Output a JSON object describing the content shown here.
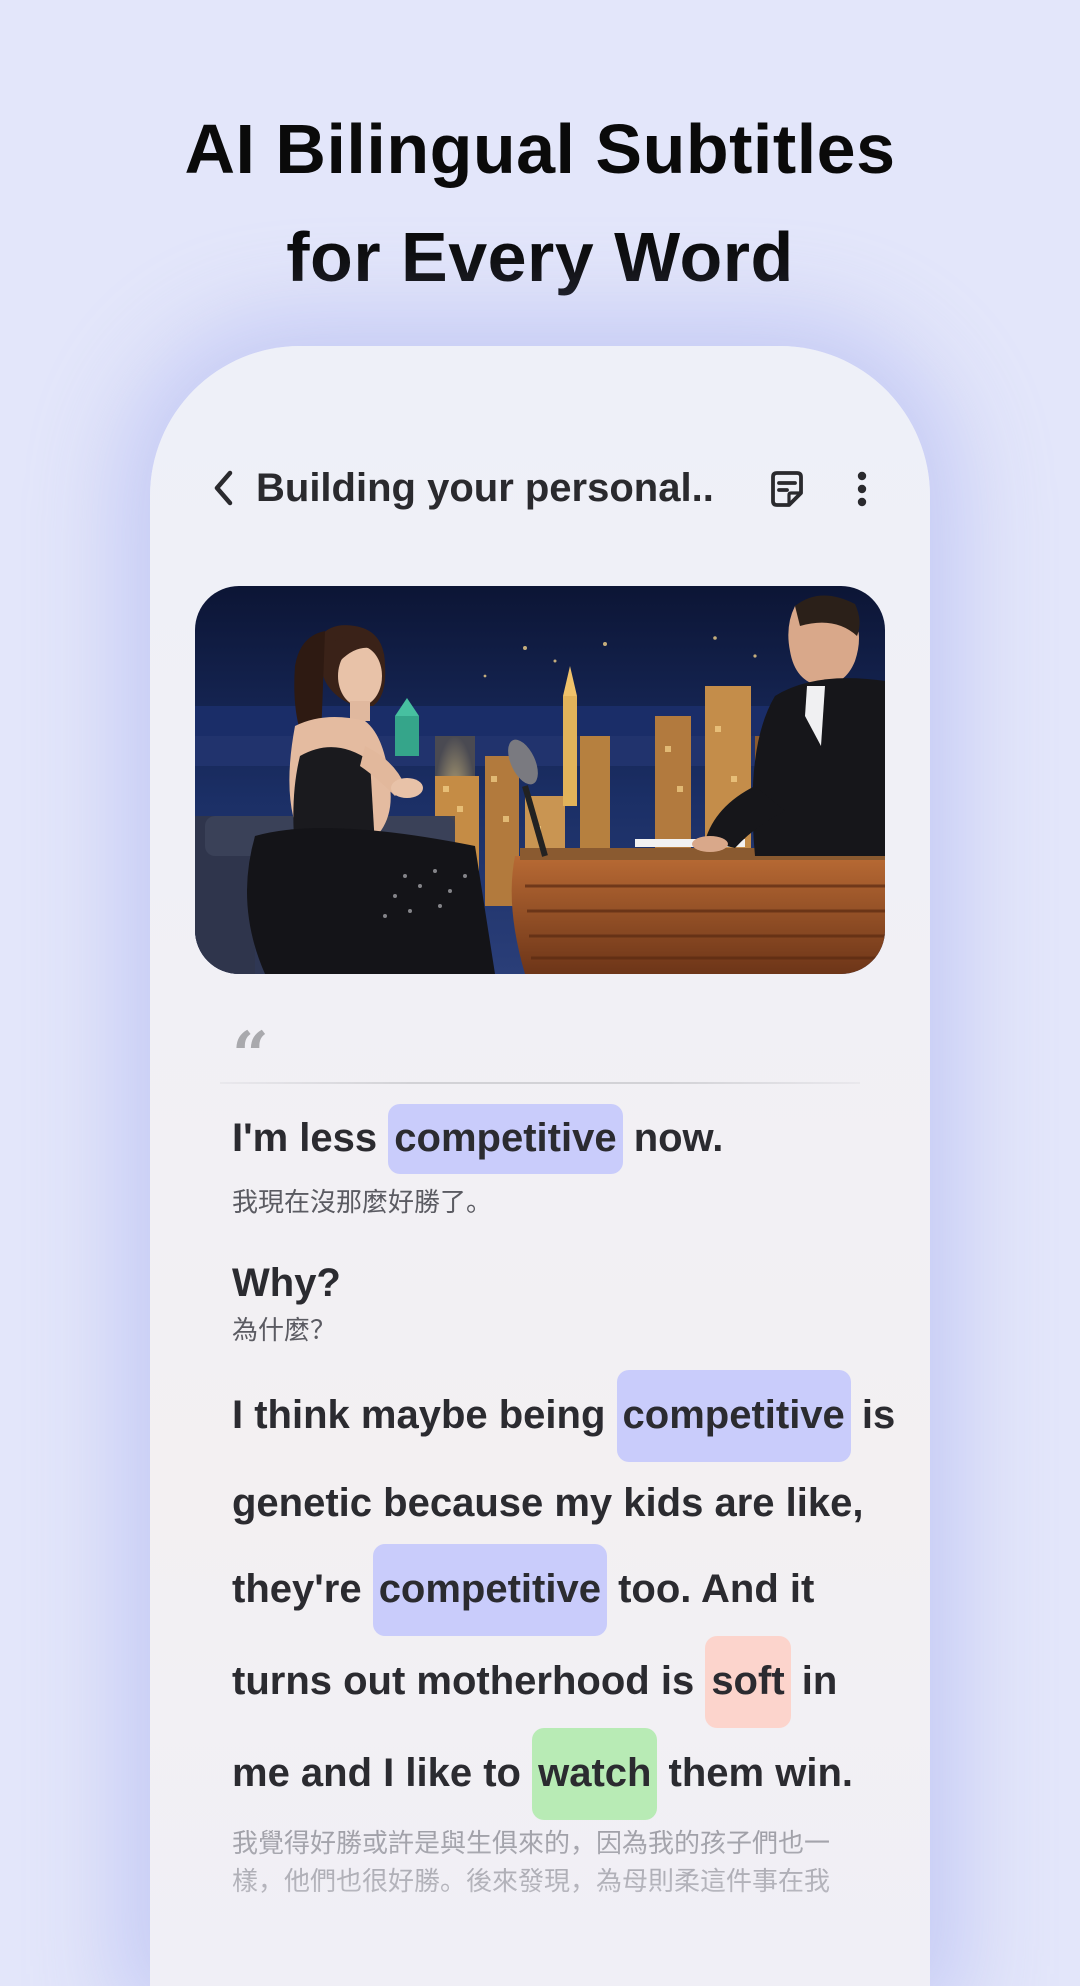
{
  "headline": {
    "line1": "AI Bilingual Subtitles",
    "line2": "for Every Word"
  },
  "header": {
    "back_icon": "chevron-left-icon",
    "title": "Building your personal...",
    "subtitle_icon": "subtitles-icon",
    "more_icon": "more-vertical-icon"
  },
  "video": {
    "thumbnail": "talk-show-interview-scene"
  },
  "quote_icon": "quote-icon",
  "quote_glyph": "“",
  "transcript": [
    {
      "en_parts": [
        "I'm less ",
        "competitive",
        " now."
      ],
      "zh": "我現在沒那麼好勝了。"
    },
    {
      "en": "Why?",
      "zh": "為什麼？"
    },
    {
      "en_lines": [
        [
          "I think maybe being ",
          "competitive",
          " is"
        ],
        [
          "genetic because my kids are like,"
        ],
        [
          "they're ",
          "competitive",
          " too. And it"
        ],
        [
          "turns out motherhood is ",
          "soft",
          " in"
        ],
        [
          "me and I like to ",
          "watch",
          " them win."
        ]
      ],
      "zh_lines": [
        "我覺得好勝或許是與生俱來的，因為我的孩子們也一",
        "樣，他們也很好勝。後來發現，為母則柔這件事在我"
      ]
    }
  ],
  "highlight_colors": {
    "blue": "#c9ccfb",
    "red": "#fcd4cc",
    "green": "#b8ebb5"
  }
}
